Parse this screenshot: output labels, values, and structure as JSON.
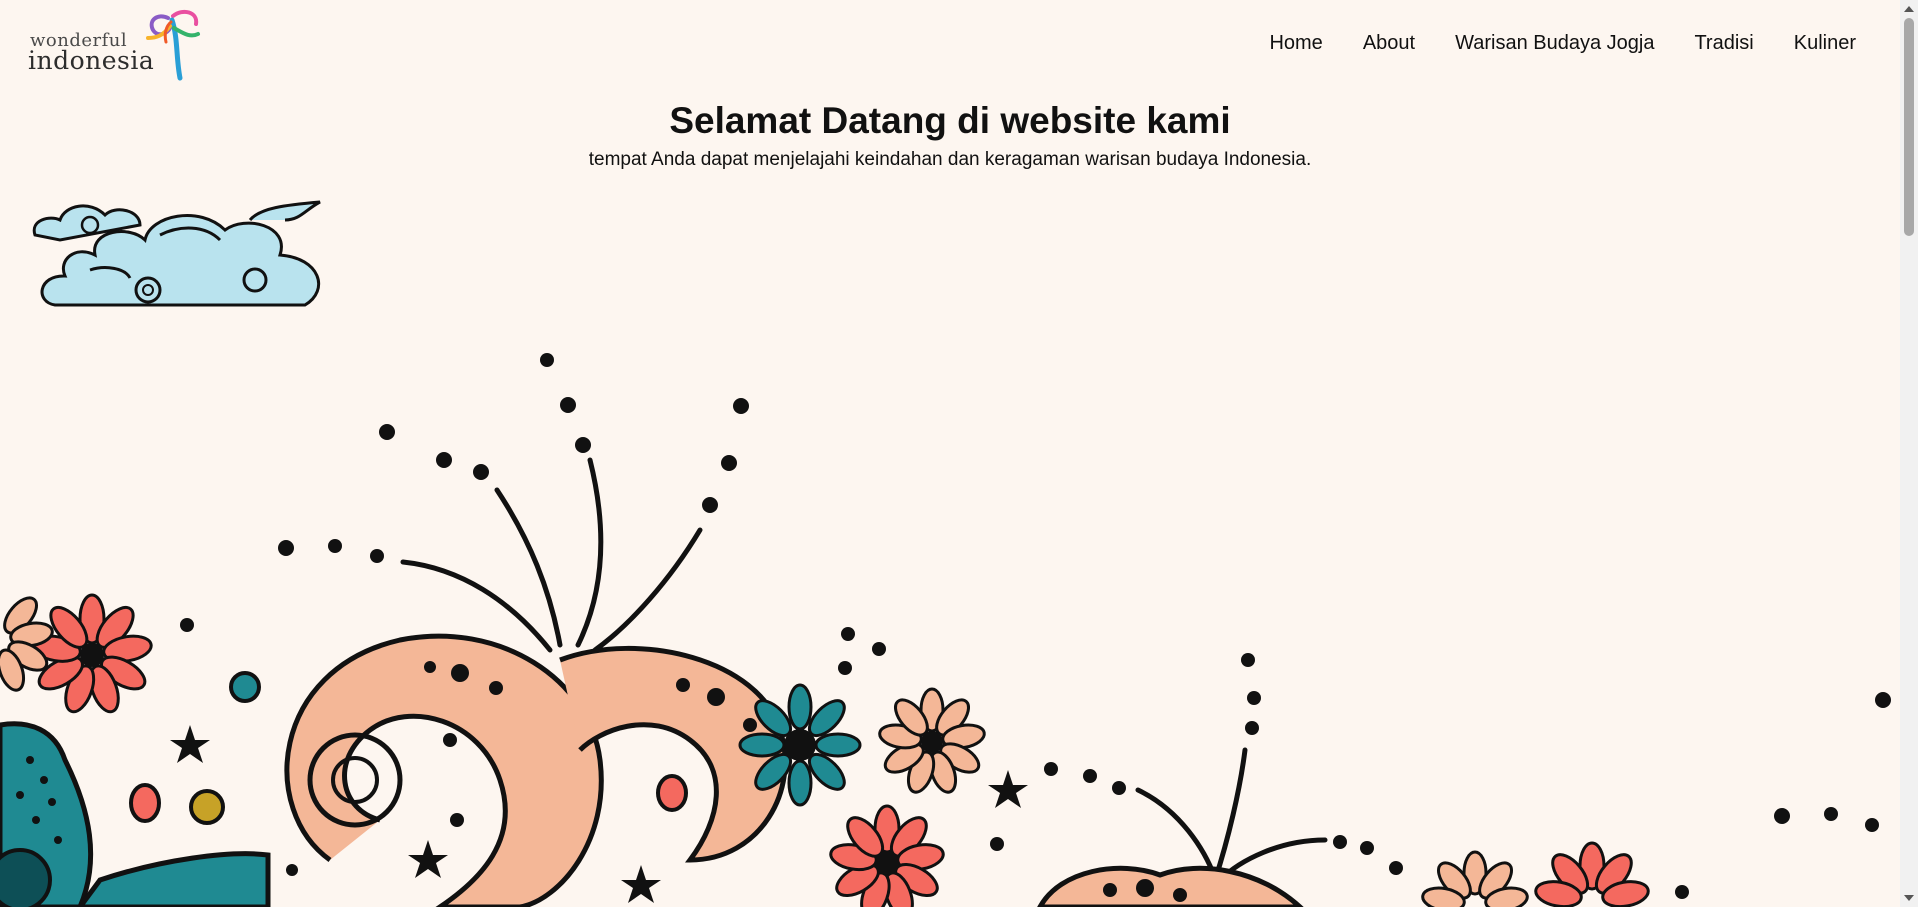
{
  "logo": {
    "line1": "wonderful",
    "line2": "indonesia"
  },
  "nav": {
    "items": [
      "Home",
      "About",
      "Warisan Budaya Jogja",
      "Tradisi",
      "Kuliner"
    ]
  },
  "hero": {
    "title": "Selamat Datang di website kami",
    "subtitle": "tempat Anda dapat menjelajahi keindahan dan keragaman warisan budaya Indonesia."
  },
  "colors": {
    "background": "#fdf6f0",
    "cloud": "#b9e3ee",
    "flower_red": "#f4695f",
    "flower_peach": "#f4b797",
    "teal": "#1f8a92",
    "gold": "#c7a227",
    "ink": "#111111"
  },
  "icons": [
    "wonderful-indonesia-logo-icon",
    "cloud-icon",
    "batik-flower-icon",
    "scroll-up-icon",
    "scroll-down-icon"
  ]
}
